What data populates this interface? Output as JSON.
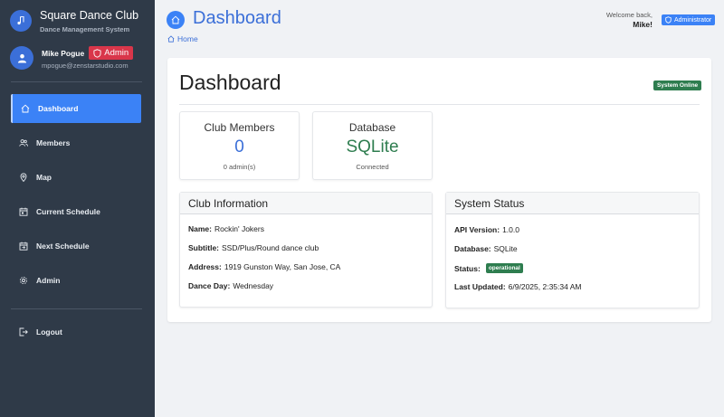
{
  "brand": {
    "title": "Square Dance Club",
    "subtitle": "Dance Management System"
  },
  "user": {
    "name": "Mike Pogue",
    "role_badge": "Admin",
    "email": "mpogue@zenstarstudio.com"
  },
  "nav": {
    "items": [
      {
        "label": "Dashboard",
        "icon": "home-icon",
        "active": true
      },
      {
        "label": "Members",
        "icon": "users-icon"
      },
      {
        "label": "Map",
        "icon": "map-pin-icon"
      },
      {
        "label": "Current Schedule",
        "icon": "calendar-icon"
      },
      {
        "label": "Next Schedule",
        "icon": "calendar-next-icon"
      },
      {
        "label": "Admin",
        "icon": "gear-icon"
      }
    ],
    "logout": "Logout"
  },
  "header": {
    "title": "Dashboard",
    "breadcrumb": "Home",
    "welcome": "Welcome back,",
    "welcome_name": "Mike!",
    "role": "Administrator"
  },
  "main": {
    "title": "Dashboard",
    "status_badge": "System Online",
    "stats": [
      {
        "label": "Club Members",
        "value": "0",
        "sub": "0 admin(s)",
        "color": "#3b6fd8"
      },
      {
        "label": "Database",
        "value": "SQLite",
        "sub": "Connected",
        "color": "#2e7d4f"
      }
    ],
    "club_info": {
      "title": "Club Information",
      "rows": [
        {
          "key": "Name:",
          "value": "Rockin' Jokers"
        },
        {
          "key": "Subtitle:",
          "value": "SSD/Plus/Round dance club"
        },
        {
          "key": "Address:",
          "value": "1919 Gunston Way, San Jose, CA"
        },
        {
          "key": "Dance Day:",
          "value": "Wednesday"
        }
      ]
    },
    "system_status": {
      "title": "System Status",
      "api_key": "API Version:",
      "api_value": "1.0.0",
      "db_key": "Database:",
      "db_value": "SQLite",
      "status_key": "Status:",
      "status_value": "operational",
      "updated_key": "Last Updated:",
      "updated_value": "6/9/2025, 2:35:34 AM"
    }
  },
  "colors": {
    "sidebar": "#2f3a48",
    "accent": "#3b82f6",
    "danger": "#d9364a",
    "success": "#2e7d4f"
  }
}
